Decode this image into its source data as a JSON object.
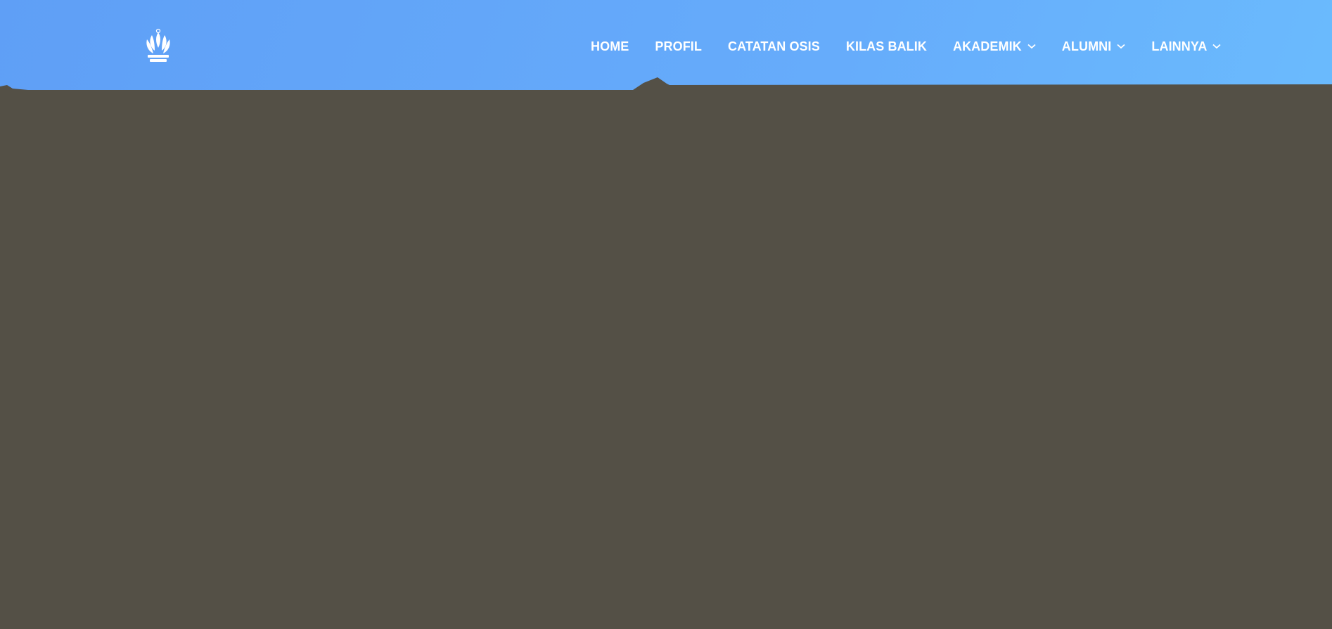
{
  "header": {
    "logo_icon": "school-emblem-icon",
    "nav": [
      {
        "label": "HOME",
        "has_dropdown": false
      },
      {
        "label": "PROFIL",
        "has_dropdown": false
      },
      {
        "label": "CATATAN OSIS",
        "has_dropdown": false
      },
      {
        "label": "KILAS BALIK",
        "has_dropdown": false
      },
      {
        "label": "AKADEMIK",
        "has_dropdown": true
      },
      {
        "label": "ALUMNI",
        "has_dropdown": true
      },
      {
        "label": "LAINNYA",
        "has_dropdown": true
      }
    ]
  },
  "colors": {
    "sky_start": "#5f9ff6",
    "sky_end": "#6cc0fe",
    "ground": "#545046",
    "nav_text": "#ffffff"
  }
}
